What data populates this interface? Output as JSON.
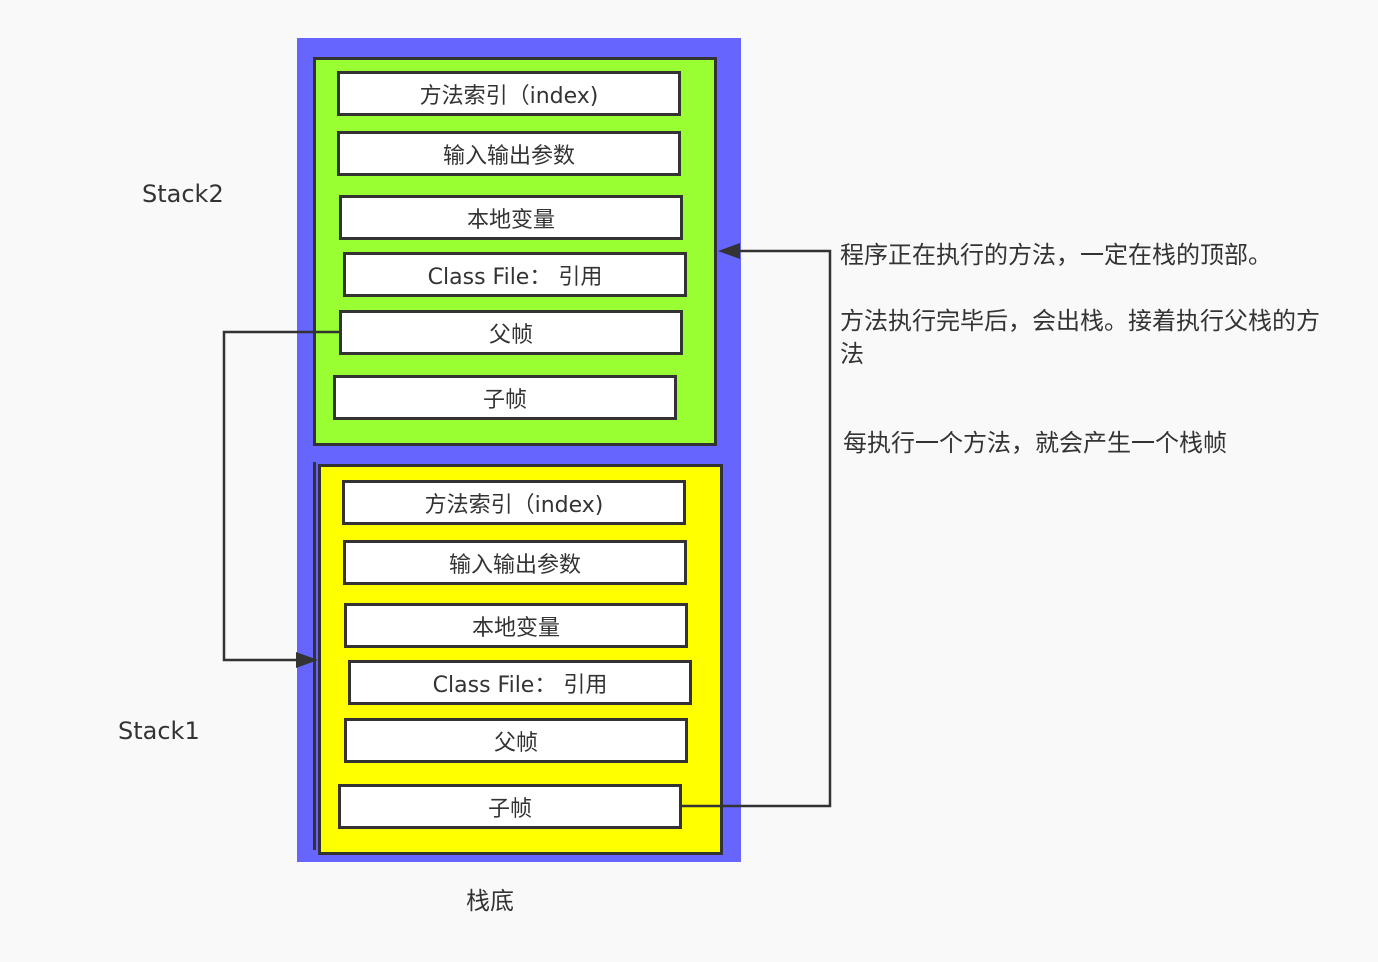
{
  "colors": {
    "outer": "#6666ff",
    "stack2_fill": "#99ff33",
    "stack1_fill": "#ffff00",
    "border": "#333333",
    "frame_fill": "#ffffff"
  },
  "stack2": {
    "label": "Stack2",
    "frames": [
      "方法索引（index)",
      "输入输出参数",
      "本地变量",
      "Class File： 引用",
      "父帧",
      "子帧"
    ]
  },
  "stack1": {
    "label": "Stack1",
    "frames": [
      "方法索引（index)",
      "输入输出参数",
      "本地变量",
      "Class File： 引用",
      "父帧",
      "子帧"
    ]
  },
  "bottom_label": "栈底",
  "notes": [
    "程序正在执行的方法，一定在栈的顶部。",
    "方法执行完毕后，会出栈。接着执行父栈的方法",
    "每执行一个方法，就会产生一个栈帧"
  ]
}
